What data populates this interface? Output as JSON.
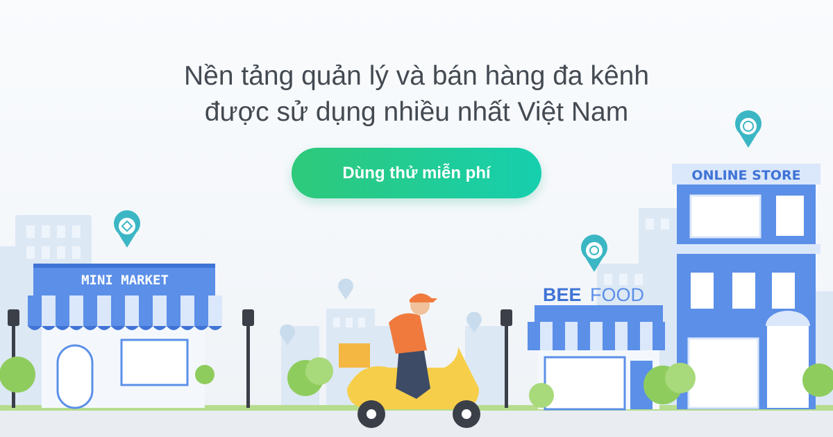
{
  "headline": {
    "line1": "Nền tảng quản lý và bán hàng đa kênh",
    "line2": "được sử dụng nhiều nhất Việt Nam"
  },
  "cta": {
    "label": "Dùng thử miễn phí"
  },
  "stores": {
    "mini_market": "MINI MARKET",
    "bee_food_bee": "BEE",
    "bee_food_food": "FOOD",
    "online_store": "ONLINE STORE"
  },
  "colors": {
    "store_blue": "#5b8fe8",
    "dark_blue": "#3f73d6",
    "awning_light": "#dbe7fb",
    "cta_start": "#2ec97a",
    "cta_end": "#16cfae",
    "pin_teal": "#3bb6c4",
    "road": "#e9edf1",
    "grass": "#b6dc8d"
  },
  "icons": [
    "location-pin-icon",
    "tag-icon",
    "fork-spoon-icon",
    "globe-cart-icon",
    "facebook-icon",
    "shopping-bag-icon",
    "heart-icon"
  ]
}
